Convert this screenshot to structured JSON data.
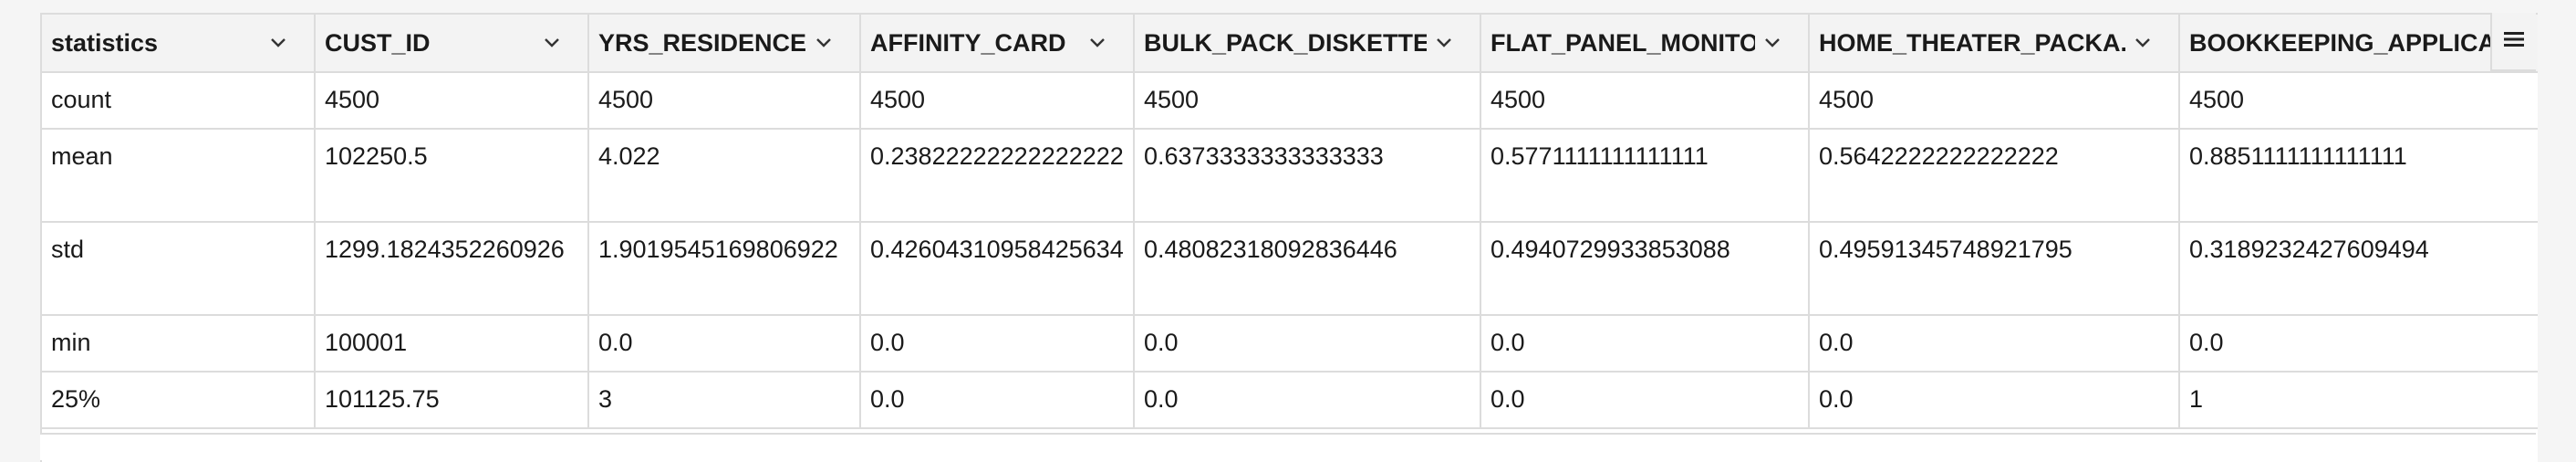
{
  "columns": [
    {
      "label": "statistics",
      "icon": "chevron-down-icon"
    },
    {
      "label": "CUST_ID",
      "icon": "chevron-down-icon"
    },
    {
      "label": "YRS_RESIDENCE .",
      "icon": "chevron-down-icon"
    },
    {
      "label": "AFFINITY_CARD",
      "icon": "chevron-down-icon"
    },
    {
      "label": "BULK_PACK_DISKETTE.",
      "icon": "chevron-down-icon"
    },
    {
      "label": "FLAT_PANEL_MONITO.",
      "icon": "chevron-down-icon"
    },
    {
      "label": "HOME_THEATER_PACKA.",
      "icon": "chevron-down-icon"
    },
    {
      "label": "BOOKKEEPING_APPLICA"
    }
  ],
  "rows": [
    {
      "cells": [
        "count",
        "4500",
        "4500",
        "4500",
        "4500",
        "4500",
        "4500",
        "4500"
      ]
    },
    {
      "cells": [
        "mean",
        "102250.5",
        "4.022",
        "0.23822222222222222",
        "0.6373333333333333",
        "0.5771111111111111",
        "0.5642222222222222",
        "0.8851111111111111"
      ]
    },
    {
      "cells": [
        "std",
        "1299.1824352260926",
        "1.9019545169806922",
        "0.42604310958425634",
        "0.48082318092836446",
        "0.4940729933853088",
        "0.49591345748921795",
        "0.3189232427609494"
      ]
    },
    {
      "cells": [
        "min",
        "100001",
        "0.0",
        "0.0",
        "0.0",
        "0.0",
        "0.0",
        "0.0"
      ]
    },
    {
      "cells": [
        "25%",
        "101125.75",
        "3",
        "0.0",
        "0.0",
        "0.0",
        "0.0",
        "1"
      ]
    }
  ],
  "menu_icon": "hamburger-menu-icon"
}
